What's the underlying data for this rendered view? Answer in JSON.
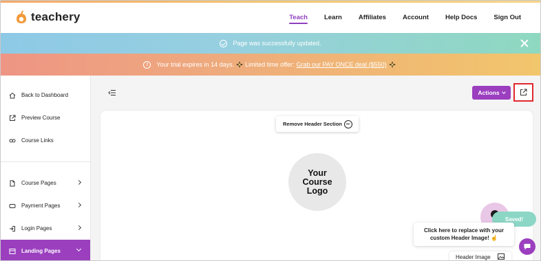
{
  "app": {
    "logo_text": "teachery"
  },
  "nav": {
    "items": [
      {
        "label": "Teach",
        "active": true
      },
      {
        "label": "Learn",
        "active": false
      },
      {
        "label": "Affiliates",
        "active": false
      },
      {
        "label": "Account",
        "active": false
      },
      {
        "label": "Help Docs",
        "active": false
      },
      {
        "label": "Sign Out",
        "active": false
      }
    ]
  },
  "banners": {
    "success": {
      "text": "Page was successfully updated."
    },
    "trial": {
      "text": "Your trial expires in 14 days.",
      "offer": "Limited time offer:",
      "deal": "Grab our PAY ONCE deal ($550)"
    }
  },
  "sidebar": {
    "top_items": [
      {
        "label": "Back to Dashboard",
        "icon": "home-icon"
      },
      {
        "label": "Preview Course",
        "icon": "external-link-icon"
      },
      {
        "label": "Course Links",
        "icon": "link-icon"
      }
    ],
    "section_items": [
      {
        "label": "Course Pages",
        "icon": "document-icon",
        "expandable": true,
        "active": false
      },
      {
        "label": "Payment Pages",
        "icon": "credit-card-icon",
        "expandable": true,
        "active": false
      },
      {
        "label": "Login Pages",
        "icon": "login-icon",
        "expandable": true,
        "active": false
      },
      {
        "label": "Landing Pages",
        "icon": "layout-icon",
        "expandable": true,
        "active": true
      }
    ]
  },
  "toolbar": {
    "actions_label": "Actions"
  },
  "editor": {
    "remove_header_label": "Remove Header Section",
    "course_logo_text": [
      "Your",
      "Course",
      "Logo"
    ],
    "saved_label": "Saved!",
    "tooltip_line1": "Click here to replace with your",
    "tooltip_line2": "custom Header Image!",
    "header_image_label": "Header Image"
  },
  "colors": {
    "brand_purple": "#9b3fbf",
    "highlight_red": "#e0282e",
    "saved_teal": "#8cd6c5"
  }
}
